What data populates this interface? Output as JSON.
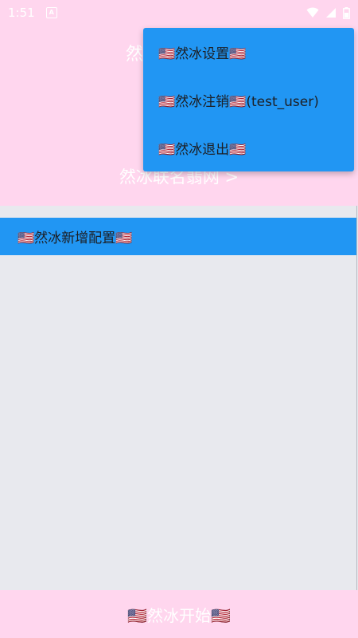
{
  "status_bar": {
    "time": "1:51",
    "app_icon": "A",
    "icons": [
      "wifi-icon",
      "signal-icon",
      "battery-icon"
    ]
  },
  "header": {
    "title_partial": "然",
    "link": "然冰联名翡网 >"
  },
  "config_bar": {
    "label": "🇺🇸然冰新增配置🇺🇸"
  },
  "bottom_bar": {
    "label": "🇺🇸然冰开始🇺🇸"
  },
  "menu": {
    "items": [
      {
        "label": "🇺🇸然冰设置🇺🇸"
      },
      {
        "label": "🇺🇸然冰注销🇺🇸(test_user)"
      },
      {
        "label": "🇺🇸然冰退出🇺🇸"
      }
    ]
  },
  "colors": {
    "header_pink": "#ffd6ee",
    "menu_blue": "#2196f3",
    "content_gray": "#e8e9ee"
  }
}
